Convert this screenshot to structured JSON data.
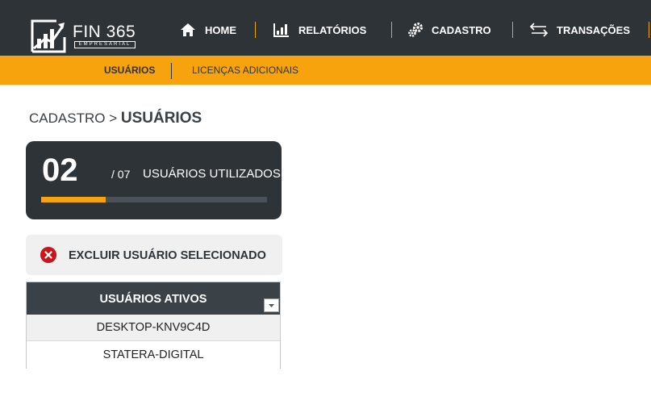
{
  "brand": {
    "name": "FIN 365",
    "tagline": "EMPRESARIAL"
  },
  "nav": {
    "items": [
      {
        "label": "HOME",
        "icon": "home-icon"
      },
      {
        "label": "RELATÓRIOS",
        "icon": "bar-chart-icon"
      },
      {
        "label": "CADASTRO",
        "icon": "gears-icon"
      },
      {
        "label": "TRANSAÇÕES",
        "icon": "transfer-arrows-icon"
      }
    ]
  },
  "subnav": {
    "items": [
      {
        "label": "USUÁRIOS",
        "active": true
      },
      {
        "label": "LICENÇAS ADICIONAIS",
        "active": false
      }
    ]
  },
  "breadcrumb": {
    "parent": "CADASTRO",
    "separator": ">",
    "current": "USUÁRIOS"
  },
  "usage": {
    "used": "02",
    "total": "/ 07",
    "label": "USUÁRIOS UTILIZADOS",
    "fraction": 0.2857
  },
  "actions": {
    "delete_label": "EXCLUIR USUÁRIO SELECIONADO"
  },
  "table": {
    "header": "USUÁRIOS ATIVOS",
    "rows": [
      "DESKTOP-KNV9C4D",
      "STATERA-DIGITAL"
    ]
  },
  "colors": {
    "dark": "#2e3338",
    "accent": "#f7a30d",
    "danger": "#c8161d"
  }
}
